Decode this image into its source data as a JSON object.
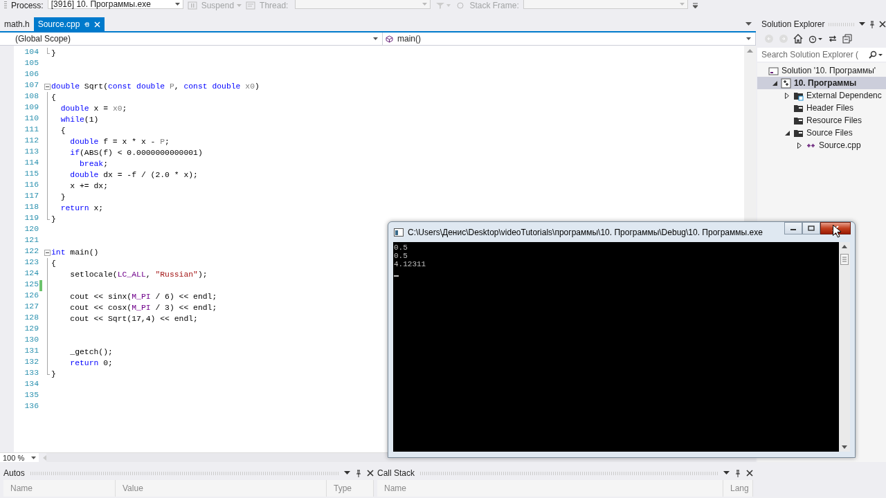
{
  "toolbar": {
    "process_label": "Process:",
    "process": "[3916] 10. Программы.exe",
    "suspend": "Suspend",
    "thread_label": "Thread:",
    "stack_frame_label": "Stack Frame:"
  },
  "tabs": [
    {
      "label": "math.h",
      "selected": false
    },
    {
      "label": "Source.cpp",
      "selected": true
    }
  ],
  "scope_bar": {
    "scope": "(Global Scope)",
    "member": "main()"
  },
  "editor": {
    "zoom": "100 %",
    "lines": [
      {
        "number": "104",
        "kind": "block-end",
        "changed": false,
        "tokens": [
          {
            "kind": "plain",
            "text": "}"
          }
        ]
      },
      {
        "number": "105",
        "kind": "plain",
        "changed": false
      },
      {
        "number": "106",
        "kind": "plain",
        "changed": false
      },
      {
        "number": "107",
        "kind": "fold-start",
        "changed": false,
        "tokens": [
          {
            "kind": "keyword",
            "text": "double"
          },
          {
            "kind": "plain",
            "text": " Sqrt("
          },
          {
            "kind": "keyword",
            "text": "const "
          },
          {
            "kind": "keyword",
            "text": "double "
          },
          {
            "kind": "param",
            "text": "P"
          },
          {
            "kind": "plain",
            "text": ", "
          },
          {
            "kind": "keyword",
            "text": "const "
          },
          {
            "kind": "keyword",
            "text": "double "
          },
          {
            "kind": "param",
            "text": "x0"
          },
          {
            "kind": "plain",
            "text": ")"
          }
        ]
      },
      {
        "number": "108",
        "kind": "block",
        "changed": false,
        "tokens": [
          {
            "kind": "plain",
            "text": "{"
          }
        ]
      },
      {
        "number": "109",
        "kind": "block",
        "changed": false,
        "tokens": [
          {
            "kind": "keyword",
            "text": "  double"
          },
          {
            "kind": "plain",
            "text": " x = "
          },
          {
            "kind": "param",
            "text": "x0"
          },
          {
            "kind": "plain",
            "text": ";"
          }
        ]
      },
      {
        "number": "110",
        "kind": "block",
        "changed": false,
        "tokens": [
          {
            "kind": "keyword",
            "text": "  while"
          },
          {
            "kind": "plain",
            "text": "(1)"
          }
        ]
      },
      {
        "number": "111",
        "kind": "block",
        "changed": false,
        "tokens": [
          {
            "kind": "plain",
            "text": "  {"
          }
        ]
      },
      {
        "number": "112",
        "kind": "block",
        "changed": false,
        "tokens": [
          {
            "kind": "keyword",
            "text": "    double"
          },
          {
            "kind": "plain",
            "text": " f = x * x - "
          },
          {
            "kind": "param",
            "text": "P"
          },
          {
            "kind": "plain",
            "text": ";"
          }
        ]
      },
      {
        "number": "113",
        "kind": "block",
        "changed": false,
        "tokens": [
          {
            "kind": "keyword",
            "text": "    if"
          },
          {
            "kind": "plain",
            "text": "(ABS(f) < 0.0000000000001)"
          }
        ]
      },
      {
        "number": "114",
        "kind": "block",
        "changed": false,
        "tokens": [
          {
            "kind": "keyword",
            "text": "      break"
          },
          {
            "kind": "plain",
            "text": ";"
          }
        ]
      },
      {
        "number": "115",
        "kind": "block",
        "changed": false,
        "tokens": [
          {
            "kind": "keyword",
            "text": "    double"
          },
          {
            "kind": "plain",
            "text": " dx = -f / (2.0 * x);"
          }
        ]
      },
      {
        "number": "116",
        "kind": "block",
        "changed": false,
        "tokens": [
          {
            "kind": "plain",
            "text": "    x += dx;"
          }
        ]
      },
      {
        "number": "117",
        "kind": "block",
        "changed": false,
        "tokens": [
          {
            "kind": "plain",
            "text": "  }"
          }
        ]
      },
      {
        "number": "118",
        "kind": "block",
        "changed": false,
        "tokens": [
          {
            "kind": "keyword",
            "text": "  return"
          },
          {
            "kind": "plain",
            "text": " x;"
          }
        ]
      },
      {
        "number": "119",
        "kind": "block-end",
        "changed": false,
        "tokens": [
          {
            "kind": "plain",
            "text": "}"
          }
        ]
      },
      {
        "number": "120",
        "kind": "plain",
        "changed": false
      },
      {
        "number": "121",
        "kind": "plain",
        "changed": false
      },
      {
        "number": "122",
        "kind": "fold-start",
        "changed": false,
        "tokens": [
          {
            "kind": "keyword",
            "text": "int"
          },
          {
            "kind": "plain",
            "text": " main()"
          }
        ]
      },
      {
        "number": "123",
        "kind": "block",
        "changed": false,
        "tokens": [
          {
            "kind": "plain",
            "text": "{"
          }
        ]
      },
      {
        "number": "124",
        "kind": "block",
        "changed": false,
        "tokens": [
          {
            "kind": "plain",
            "text": "    setlocale("
          },
          {
            "kind": "macro",
            "text": "LC_ALL"
          },
          {
            "kind": "plain",
            "text": ", "
          },
          {
            "kind": "string",
            "text": "\"Russian\""
          },
          {
            "kind": "plain",
            "text": ");"
          }
        ]
      },
      {
        "number": "125",
        "kind": "block",
        "changed": true
      },
      {
        "number": "126",
        "kind": "block",
        "changed": false,
        "tokens": [
          {
            "kind": "plain",
            "text": "    cout << sinx("
          },
          {
            "kind": "macro",
            "text": "M_PI"
          },
          {
            "kind": "plain",
            "text": " / 6) << endl;"
          }
        ]
      },
      {
        "number": "127",
        "kind": "block",
        "changed": false,
        "tokens": [
          {
            "kind": "plain",
            "text": "    cout << cosx("
          },
          {
            "kind": "macro",
            "text": "M_PI"
          },
          {
            "kind": "plain",
            "text": " / 3) << endl;"
          }
        ]
      },
      {
        "number": "128",
        "kind": "block",
        "changed": false,
        "tokens": [
          {
            "kind": "plain",
            "text": "    cout << Sqrt(17,4) << endl;"
          }
        ]
      },
      {
        "number": "129",
        "kind": "block",
        "changed": false
      },
      {
        "number": "130",
        "kind": "block",
        "changed": false
      },
      {
        "number": "131",
        "kind": "block",
        "changed": false,
        "tokens": [
          {
            "kind": "plain",
            "text": "    _getch();"
          }
        ]
      },
      {
        "number": "132",
        "kind": "block",
        "changed": false,
        "tokens": [
          {
            "kind": "keyword",
            "text": "    return"
          },
          {
            "kind": "plain",
            "text": " 0;"
          }
        ]
      },
      {
        "number": "133",
        "kind": "block-end",
        "changed": false,
        "tokens": [
          {
            "kind": "plain",
            "text": "}"
          }
        ]
      },
      {
        "number": "134",
        "kind": "plain",
        "changed": false
      },
      {
        "number": "135",
        "kind": "plain",
        "changed": false
      },
      {
        "number": "136",
        "kind": "plain",
        "changed": false
      }
    ]
  },
  "console": {
    "title": "C:\\Users\\Денис\\Desktop\\videoTutorials\\программы\\10. Программы\\Debug\\10. Программы.exe",
    "output": [
      "0.5",
      "0.5",
      "4.12311"
    ]
  },
  "solution_explorer": {
    "title": "Solution Explorer",
    "search_placeholder": "Search Solution Explorer (",
    "tree": [
      {
        "label": "Solution '10. Программы'",
        "kind": "solution",
        "selected": false,
        "children": [
          {
            "label": "10. Программы",
            "kind": "project",
            "selected": true,
            "expanded": true,
            "children": [
              {
                "label": "External Dependenc",
                "kind": "external",
                "selected": false,
                "expanded": false
              },
              {
                "label": "Header Files",
                "kind": "folder",
                "selected": false
              },
              {
                "label": "Resource Files",
                "kind": "folder",
                "selected": false
              },
              {
                "label": "Source Files",
                "kind": "folder",
                "selected": false,
                "expanded": true,
                "children": [
                  {
                    "label": "Source.cpp",
                    "kind": "cpp",
                    "selected": false,
                    "expanded": false
                  }
                ]
              }
            ]
          }
        ]
      }
    ]
  },
  "autos": {
    "title": "Autos",
    "columns": [
      "Name",
      "Value",
      "Type"
    ]
  },
  "call_stack": {
    "title": "Call Stack",
    "columns": [
      "Name",
      "Lang"
    ]
  }
}
